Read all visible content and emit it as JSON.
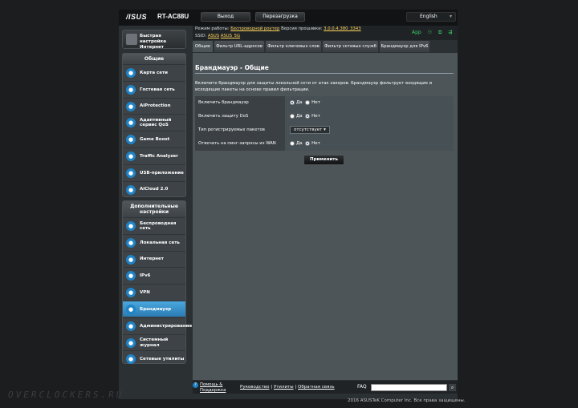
{
  "header": {
    "logo": "/ISUS",
    "model": "RT-AC88U",
    "logout": "Выход",
    "reboot": "Перезагрузка",
    "language": "English"
  },
  "infobar": {
    "mode_label": "Режим работы:",
    "mode_value": "Беспроводной роутер",
    "fw_label": "Версия прошивки:",
    "fw_value": "3.0.0.4.380_3343",
    "ssid_label": "SSID:",
    "ssid_1": "ASUS",
    "ssid_2": "ASUS_5G",
    "app": "App"
  },
  "quick_setup": {
    "label": "Быстрая настройка Интернет"
  },
  "sidebar": {
    "general_title": "Общие",
    "general": [
      {
        "label": "Карта сети",
        "icon": "network-map-icon"
      },
      {
        "label": "Гостевая сеть",
        "icon": "guest-network-icon"
      },
      {
        "label": "AiProtection",
        "icon": "aiprotection-icon"
      },
      {
        "label": "Адаптивный сервис QoS",
        "icon": "qos-icon"
      },
      {
        "label": "Game Boost",
        "icon": "game-boost-icon"
      },
      {
        "label": "Traffic Analyzer",
        "icon": "traffic-analyzer-icon"
      },
      {
        "label": "USB-приложение",
        "icon": "usb-icon"
      },
      {
        "label": "AiCloud 2.0",
        "icon": "aicloud-icon"
      }
    ],
    "advanced_title": "Дополнительные настройки",
    "advanced": [
      {
        "label": "Беспроводная сеть",
        "icon": "wireless-icon"
      },
      {
        "label": "Локальная сеть",
        "icon": "lan-icon"
      },
      {
        "label": "Интернет",
        "icon": "internet-icon"
      },
      {
        "label": "IPv6",
        "icon": "ipv6-icon"
      },
      {
        "label": "VPN",
        "icon": "vpn-icon"
      },
      {
        "label": "Брандмауэр",
        "icon": "firewall-icon",
        "active": true
      },
      {
        "label": "Администрирование",
        "icon": "admin-icon"
      },
      {
        "label": "Системный журнал",
        "icon": "syslog-icon"
      },
      {
        "label": "Сетевые утилиты",
        "icon": "network-tools-icon"
      }
    ]
  },
  "tabs": [
    "Общие",
    "Фильтр URL-адресов",
    "Фильтр ключевых слов",
    "Фильтр сетевых служб",
    "Брандмауэр для IPv6"
  ],
  "main": {
    "title": "Брандмауэр - Общие",
    "description": "Включите брандмауэр для защиты локальной сети от атак хакеров. Брандмауэр фильтрует входящие и исходящие пакеты на основе правил фильтрации.",
    "rows": [
      {
        "label": "Включить брандмауэр",
        "yes": "Да",
        "no": "Нет",
        "selected": "yes"
      },
      {
        "label": "Включить защиту DoS",
        "yes": "Да",
        "no": "Нет",
        "selected": "no"
      },
      {
        "label": "Тип регистрируемых пакетов",
        "select": "отсутствует"
      },
      {
        "label": "Отвечать на пинг-запросы из WAN",
        "yes": "Да",
        "no": "Нет",
        "selected": "no"
      }
    ],
    "apply": "Применить"
  },
  "footer": {
    "help": "Помощь & Поддержка",
    "manual": "Руководство",
    "utilities": "Утилиты",
    "feedback": "Обратная связь",
    "sep": "|",
    "faq": "FAQ",
    "copyright": "2016 ASUSTeK Computer Inc. Все права защищены."
  },
  "watermark": "OVERCLOCKERS.RU",
  "colors": {
    "accent": "#1f83c6",
    "active_nav": "#3a95cf",
    "link_yellow": "#ffd55a",
    "status_green": "#3cd36a"
  }
}
